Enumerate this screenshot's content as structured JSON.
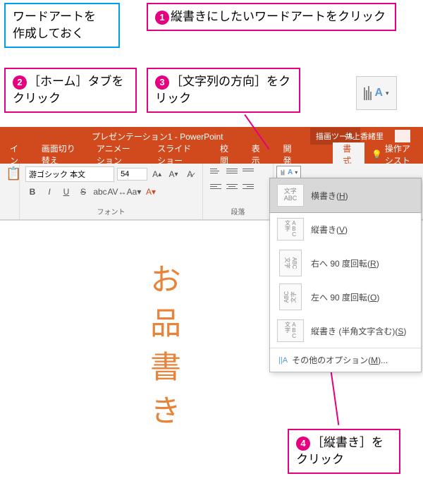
{
  "callouts": {
    "prep": "ワードアートを\n作成しておく",
    "step1_num": "1",
    "step1_text": "縦書きにしたいワードアートをクリック",
    "step2_num": "2",
    "step2_text": "［ホーム］タブをクリック",
    "step3_num": "3",
    "step3_text": "［文字列の方向］をクリック",
    "step4_num": "4",
    "step4_text": "［縦書き］をクリック"
  },
  "app": {
    "title": "プレゼンテーション1 - PowerPoint",
    "drawing_tools": "描画ツール",
    "user": "井上香緒里",
    "tabs": {
      "t0": "イン",
      "t1": "画面切り替え",
      "t2": "アニメーション",
      "t3": "スライド ショー",
      "t4": "校閲",
      "t5": "表示",
      "t6": "開発",
      "format": "書式",
      "tell_me": "操作アシスト"
    },
    "font": {
      "name": "游ゴシック 本文",
      "size": "54",
      "group_label": "フォント"
    },
    "paragraph": {
      "group_label": "段落"
    }
  },
  "slide": {
    "wordart": "お品書き"
  },
  "text_direction_icon": {
    "A": "A",
    "arrow": "▾"
  },
  "menu": {
    "horizontal": "横書き(",
    "horizontal_key": "H",
    "horizontal_icon": "文字\nABC",
    "vertical": "縦書き(",
    "vertical_key": "V",
    "vertical_icon": "文 A\n字 B\n　 C",
    "rotate_right": "右へ 90 度回転(",
    "rotate_right_key": "R",
    "rotate_left": "左へ 90 度回転(",
    "rotate_left_key": "O",
    "vertical_half": "縦書き (半角文字含む)(",
    "vertical_half_key": "S",
    "other": "その他のオプション(",
    "other_key": "M",
    "other_suffix": ")...",
    "close": ")",
    "other_icon": "||A"
  }
}
